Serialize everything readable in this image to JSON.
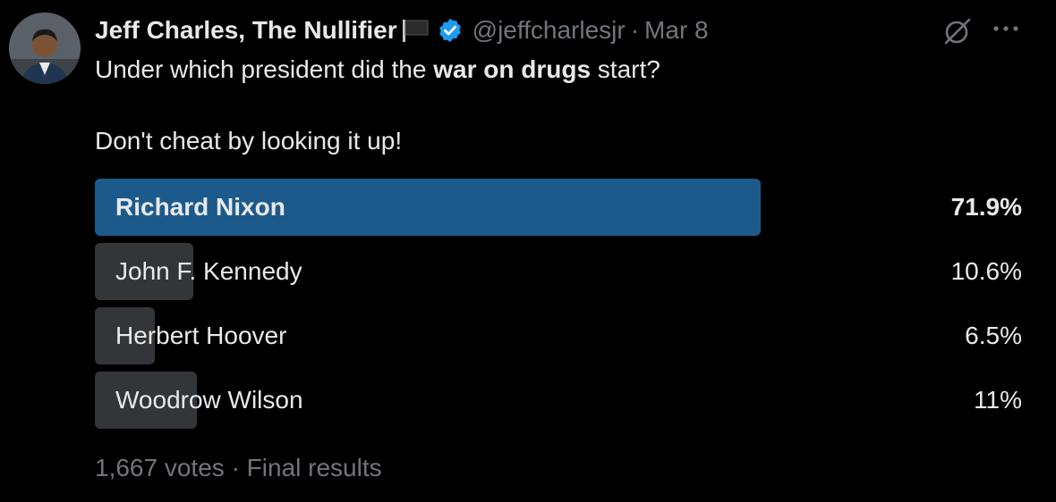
{
  "author": {
    "name": "Jeff Charles, The Nullifier",
    "handle": "@jeffcharlesjr",
    "date": "Mar 8",
    "separator": "·"
  },
  "tweet": {
    "text_before": "Under which president did the ",
    "text_bold": "war on drugs",
    "text_after": " start?",
    "second_line": "Don't cheat by looking it up!"
  },
  "poll": {
    "options": [
      {
        "label": "Richard Nixon",
        "percent_label": "71.9%",
        "bar_fraction": 0.719,
        "winner": true
      },
      {
        "label": "John F. Kennedy",
        "percent_label": "10.6%",
        "bar_fraction": 0.106,
        "winner": false
      },
      {
        "label": "Herbert Hoover",
        "percent_label": "6.5%",
        "bar_fraction": 0.065,
        "winner": false
      },
      {
        "label": "Woodrow Wilson",
        "percent_label": "11%",
        "bar_fraction": 0.11,
        "winner": false
      }
    ],
    "votes": "1,667 votes",
    "separator": "·",
    "status": "Final results"
  },
  "colors": {
    "background": "#000000",
    "text": "#e7e9ea",
    "muted": "#71767b",
    "winner_bar": "#1d5a8c",
    "bar": "#333639",
    "verified": "#1d9bf0"
  },
  "icons": {
    "verified": "verified-badge-icon",
    "flag": "black-flag-icon",
    "grok": "grok-icon",
    "more": "more-icon"
  }
}
